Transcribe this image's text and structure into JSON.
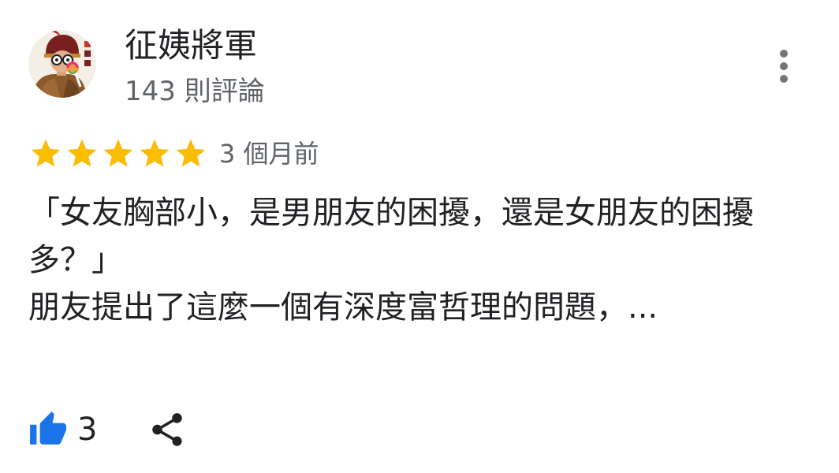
{
  "author": {
    "name": "征姨將軍",
    "review_count": "143 則評論",
    "avatar_icon": "general-portrait-avatar"
  },
  "review": {
    "rating": 5,
    "rating_max": 5,
    "time": "3 個月前",
    "line1": "「女友胸部小，是男朋友的困擾，還是女朋友的困擾多？」",
    "line2": "朋友提出了這麼一個有深度富哲理的問題，..."
  },
  "actions": {
    "like_icon": "thumbs-up-icon",
    "like_count": "3",
    "share_icon": "share-icon",
    "more_icon": "more-vertical-icon"
  },
  "colors": {
    "star": "#fbbc04",
    "like": "#1a73e8",
    "text": "#202124",
    "muted": "#5f6368",
    "more_dots": "#757575"
  }
}
